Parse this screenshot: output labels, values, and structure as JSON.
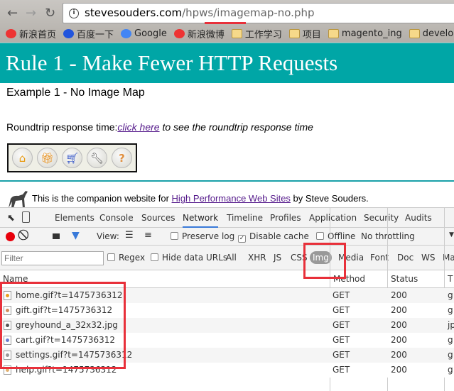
{
  "browser": {
    "url_host": "stevesouders.com",
    "url_path": "/hpws/imagemap-no.php",
    "bookmarks": [
      "新浪首页",
      "百度一下",
      "Google",
      "新浪微博",
      "工作学习",
      "项目",
      "magento_ing",
      "develop"
    ]
  },
  "page": {
    "title": "Rule 1 - Make Fewer HTTP Requests",
    "example": "Example 1 - No Image Map",
    "roundtrip_label": "Roundtrip response time:",
    "roundtrip_link": "click here",
    "roundtrip_rest": " to see the roundtrip response time",
    "icons": [
      "home-icon",
      "gift-icon",
      "cart-icon",
      "settings-icon",
      "help-icon"
    ],
    "companion_pre": "This is the companion website for ",
    "companion_link": "High Performance Web Sites",
    "companion_post": " by Steve Souders."
  },
  "devtools": {
    "tabs": [
      "Elements",
      "Console",
      "Sources",
      "Network",
      "Timeline",
      "Profiles",
      "Application",
      "Security",
      "Audits"
    ],
    "active_tab": "Network",
    "view_label": "View:",
    "preserve_log": "Preserve log",
    "disable_cache": "Disable cache",
    "offline": "Offline",
    "throttling": "No throttling",
    "filter_placeholder": "Filter",
    "regex": "Regex",
    "hide_data_urls": "Hide data URLs",
    "types": [
      "All",
      "XHR",
      "JS",
      "CSS",
      "Img",
      "Media",
      "Font",
      "Doc",
      "WS",
      "Ma"
    ],
    "active_type": "Img",
    "columns": [
      "Name",
      "Method",
      "Status",
      "T"
    ],
    "rows": [
      {
        "name": "home.gif?t=1475736312",
        "method": "GET",
        "status": "200",
        "type": "g"
      },
      {
        "name": "gift.gif?t=1475736312",
        "method": "GET",
        "status": "200",
        "type": "g"
      },
      {
        "name": "greyhound_a_32x32.jpg",
        "method": "GET",
        "status": "200",
        "type": "jp"
      },
      {
        "name": "cart.gif?t=1475736312",
        "method": "GET",
        "status": "200",
        "type": "g"
      },
      {
        "name": "settings.gif?t=1475736312",
        "method": "GET",
        "status": "200",
        "type": "g"
      },
      {
        "name": "help.gif?t=1475736312",
        "method": "GET",
        "status": "200",
        "type": "g"
      }
    ]
  },
  "colors": {
    "header": "#00a6a6",
    "highlight": "#e8303a",
    "accent": "#3879d9"
  }
}
